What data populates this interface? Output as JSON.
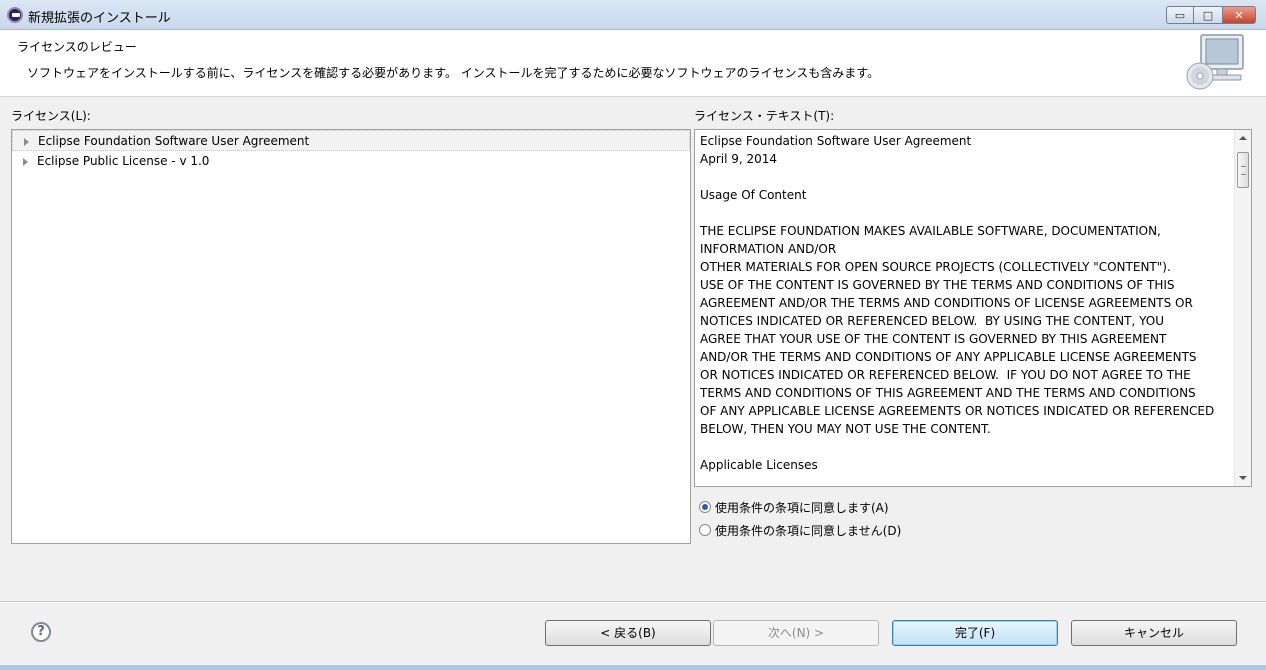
{
  "window": {
    "title": "新規拡張のインストール",
    "controls": {
      "minimize": "▭",
      "maximize": "□",
      "close": "✕"
    }
  },
  "banner": {
    "title": "ライセンスのレビュー",
    "description": "ソフトウェアをインストールする前に、ライセンスを確認する必要があります。 インストールを完了するために必要なソフトウェアのライセンスも含みます。",
    "graphic": "computer-cd-icon"
  },
  "licenses": {
    "label": "ライセンス(L):",
    "items": [
      {
        "label": "Eclipse Foundation Software User Agreement",
        "selected": true
      },
      {
        "label": "Eclipse Public License - v 1.0",
        "selected": false
      }
    ]
  },
  "license_text": {
    "label": "ライセンス・テキスト(T):",
    "content": "Eclipse Foundation Software User Agreement\nApril 9, 2014\n\nUsage Of Content\n\nTHE ECLIPSE FOUNDATION MAKES AVAILABLE SOFTWARE, DOCUMENTATION,\nINFORMATION AND/OR\nOTHER MATERIALS FOR OPEN SOURCE PROJECTS (COLLECTIVELY \"CONTENT\").\nUSE OF THE CONTENT IS GOVERNED BY THE TERMS AND CONDITIONS OF THIS\nAGREEMENT AND/OR THE TERMS AND CONDITIONS OF LICENSE AGREEMENTS OR\nNOTICES INDICATED OR REFERENCED BELOW.  BY USING THE CONTENT, YOU\nAGREE THAT YOUR USE OF THE CONTENT IS GOVERNED BY THIS AGREEMENT\nAND/OR THE TERMS AND CONDITIONS OF ANY APPLICABLE LICENSE AGREEMENTS\nOR NOTICES INDICATED OR REFERENCED BELOW.  IF YOU DO NOT AGREE TO THE\nTERMS AND CONDITIONS OF THIS AGREEMENT AND THE TERMS AND CONDITIONS\nOF ANY APPLICABLE LICENSE AGREEMENTS OR NOTICES INDICATED OR REFERENCED\nBELOW, THEN YOU MAY NOT USE THE CONTENT.\n\nApplicable Licenses"
  },
  "agreement": {
    "accept": {
      "label": "使用条件の条項に同意します(A)",
      "checked": true
    },
    "decline": {
      "label": "使用条件の条項に同意しません(D)",
      "checked": false
    }
  },
  "footer": {
    "help": "?",
    "back": "< 戻る(B)",
    "next": "次へ(N) >",
    "finish": "完了(F)",
    "cancel": "キャンセル"
  },
  "colors": {
    "radio_accent": "#2a5db8",
    "default_button_border": "#3c7fb1",
    "titlebar": "#c9d9ec"
  }
}
